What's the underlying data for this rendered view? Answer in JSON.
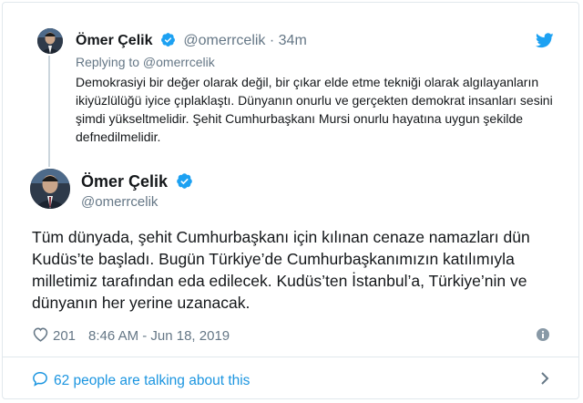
{
  "reply_tweet": {
    "author_name": "Ömer Çelik",
    "handle": "@omerrcelik",
    "separator": "·",
    "time": "34m",
    "replying_to": "Replying to @omerrcelik",
    "text": "Demokrasiyi bir değer olarak değil, bir çıkar elde etme tekniği olarak algılayanların ikiyüzlülüğü iyice çıplaklaştı. Dünyanın onurlu ve gerçekten demokrat insanları sesini şimdi yükseltmelidir. Şehit Cumhurbaşkanı Mursi onurlu hayatına uygun şekilde defnedilmelidir."
  },
  "main_tweet": {
    "author_name": "Ömer Çelik",
    "handle": "@omerrcelik",
    "text": "Tüm dünyada, şehit Cumhurbaşkanı için kılınan cenaze namazları dün Kudüs’te başladı. Bugün Türkiye’de Cumhurbaşkanımızın katılımıyla milletimiz tarafından eda edilecek. Kudüs’ten İstanbul’a, Türkiye’nin ve dünyanın her yerine uzanacak.",
    "likes": "201",
    "timestamp": "8:46 AM - Jun 18, 2019"
  },
  "footer": {
    "talking_text": "62 people are talking about this"
  },
  "icons": {
    "verified": "verified-badge-icon",
    "twitter": "twitter-bird-icon",
    "like": "heart-icon",
    "info": "info-icon",
    "comment": "speech-bubble-icon",
    "chevron": "chevron-right-icon"
  },
  "colors": {
    "accent": "#1da1f2",
    "link": "#1b95e0",
    "muted": "#657786",
    "text": "#14171a",
    "border": "#e1e8ed"
  }
}
